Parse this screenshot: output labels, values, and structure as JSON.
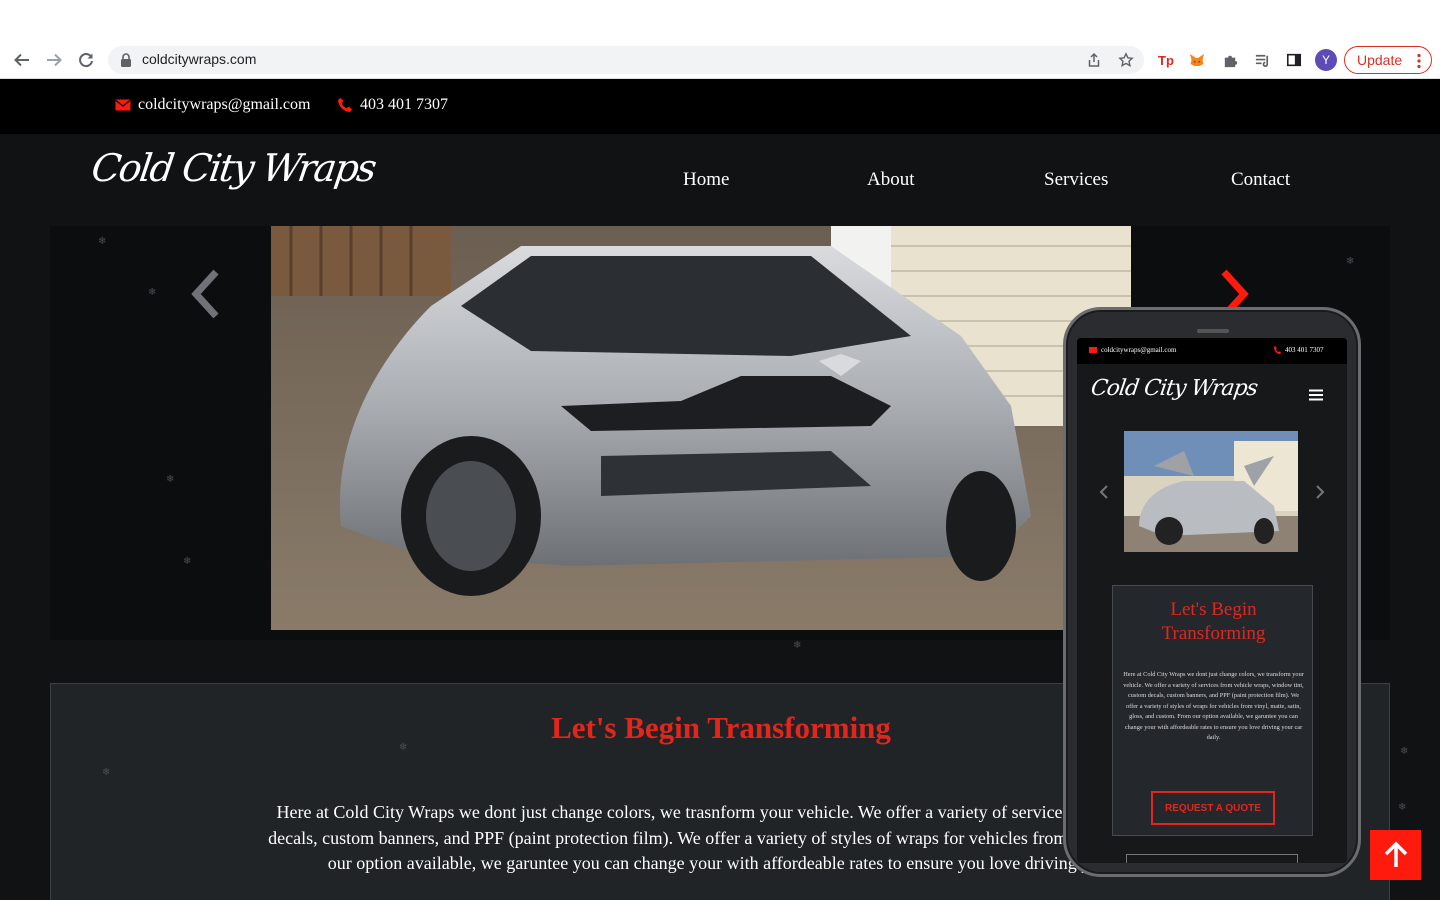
{
  "browser": {
    "url": "coldcitywraps.com",
    "profile_initial": "Y",
    "update_label": "Update",
    "extensions": [
      "tp-extension-icon",
      "metamask-icon",
      "puzzle-extensions-icon",
      "media-queue-icon",
      "side-panel-icon"
    ]
  },
  "topbar": {
    "email": "coldcitywraps@gmail.com",
    "phone": "403 401 7307"
  },
  "header": {
    "logo_text": "Cold City Wraps",
    "nav": [
      "Home",
      "About",
      "Services",
      "Contact"
    ]
  },
  "hero": {
    "prev_icon": "chevron-left-icon",
    "next_icon": "chevron-right-icon"
  },
  "intro": {
    "title": "Let's Begin Transforming",
    "line1": "Here at Cold City Wraps we dont just change colors, we trasnform your vehicle. We offer a variety of services from vehicle",
    "line2": "decals, custom banners, and PPF (paint protection film). We offer a variety of styles of wraps for vehicles from vinyl, matte, s",
    "line3": "our option available, we garuntee you can change your with affordeable rates to ensure you love driving your"
  },
  "phone_preview": {
    "email": "coldcitywraps@gmail.com",
    "phone": "403 401 7307",
    "logo_text": "Cold City Wraps",
    "title_line1": "Let's Begin",
    "title_line2": "Transforming",
    "body": "Here at Cold City Wraps we dont just change colors, we transform your vehicle. We offer a variety of services from vehicle wraps, window tint, custom decals, custom banners, and PPF (paint protection film). We offer a variety of styles of wraps for vehicles from vinyl, matte, satin, gloss, and custom. From our option available, we garuntee you can change your with affordeable rates to ensure you love driving your car daily.",
    "quote_button": "REQUEST A QUOTE"
  },
  "colors": {
    "accent_red": "#e3261c",
    "background": "#111213",
    "topbar": "#000000",
    "section": "#202427"
  }
}
